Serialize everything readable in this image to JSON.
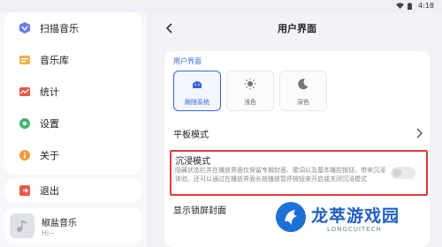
{
  "status_bar": {
    "time": "4:18"
  },
  "sidebar": {
    "items": [
      {
        "label": "扫描音乐",
        "icon": "scan-music-icon"
      },
      {
        "label": "音乐库",
        "icon": "music-library-icon"
      },
      {
        "label": "统计",
        "icon": "stats-icon"
      },
      {
        "label": "设置",
        "icon": "settings-icon"
      },
      {
        "label": "关于",
        "icon": "about-icon"
      }
    ],
    "exit": {
      "label": "退出",
      "icon": "exit-icon"
    }
  },
  "player": {
    "title": "椒盐音乐",
    "subtitle": "Hi~"
  },
  "header": {
    "title": "用户界面"
  },
  "section": {
    "label": "用户界面",
    "theme_modes": [
      {
        "label": "跟随系统",
        "icon": "android-icon",
        "selected": true
      },
      {
        "label": "浅色",
        "icon": "sun-icon",
        "selected": false
      },
      {
        "label": "深色",
        "icon": "moon-icon",
        "selected": false
      }
    ],
    "tablet_mode": {
      "title": "平板模式"
    },
    "immersive": {
      "title": "沉浸模式",
      "description": "隐藏状态栏并在播放界面仅保留专辑封面、歌词以及基本播控按钮，带来沉浸体验。还可以通过在播放界面长按播放暂停按钮来开启或关闭沉浸模式",
      "enabled": false
    },
    "cover_row": {
      "title": "显示锁屏封面"
    }
  },
  "watermark": {
    "text": "龙萃游戏园",
    "domain": "LONGCUITECH"
  },
  "colors": {
    "accent": "#3a66d6",
    "highlight_border": "#e53a3a",
    "watermark_blue": "#1e5fc2"
  }
}
